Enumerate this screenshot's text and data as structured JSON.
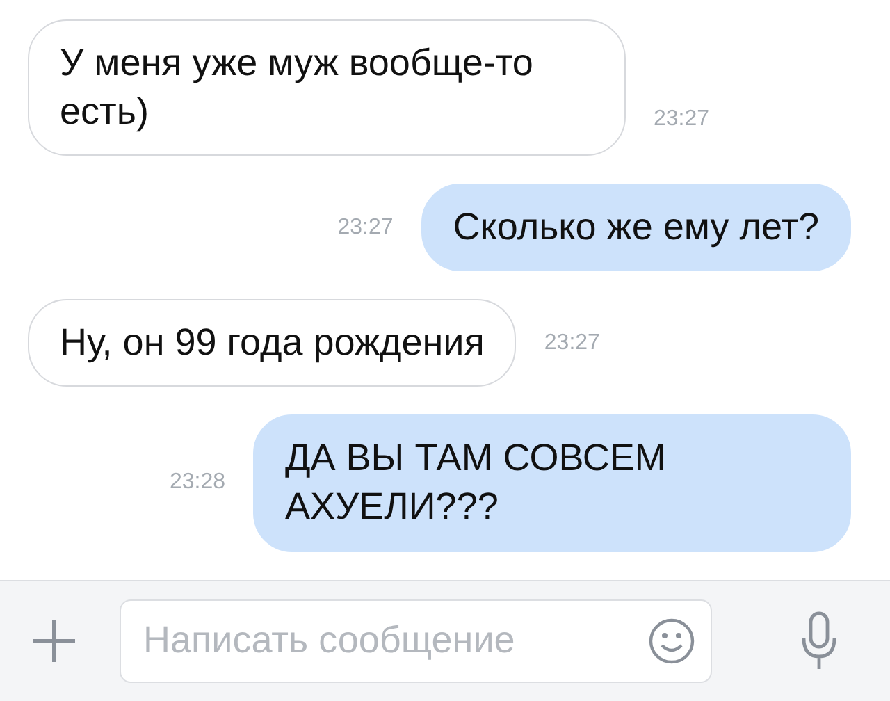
{
  "messages": [
    {
      "text": "У меня уже муж вообще-то есть)",
      "time": "23:27",
      "outgoing": false
    },
    {
      "text": "Сколько же ему лет?",
      "time": "23:27",
      "outgoing": true
    },
    {
      "text": "Ну, он 99 года рождения",
      "time": "23:27",
      "outgoing": false
    },
    {
      "text": "ДА ВЫ ТАМ СОВСЕМ АХУЕЛИ???",
      "time": "23:28",
      "outgoing": true
    }
  ],
  "compose": {
    "placeholder": "Написать сообщение"
  }
}
